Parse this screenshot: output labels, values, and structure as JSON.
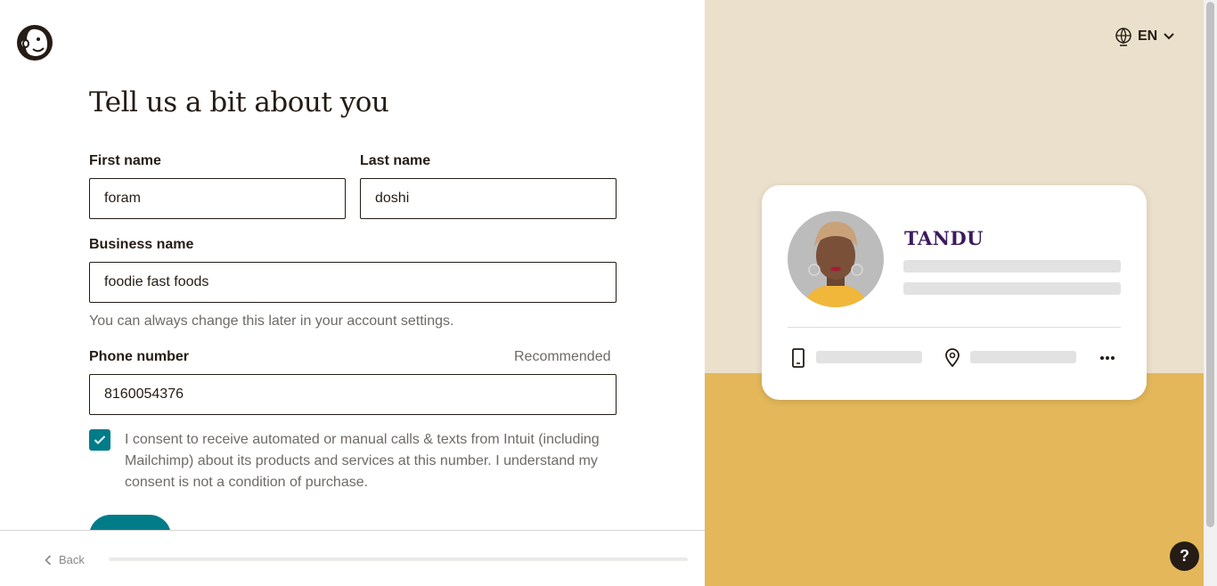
{
  "header": {
    "title": "Tell us a bit about you"
  },
  "form": {
    "first_name": {
      "label": "First name",
      "value": "foram"
    },
    "last_name": {
      "label": "Last name",
      "value": "doshi"
    },
    "business_name": {
      "label": "Business name",
      "value": "foodie fast foods",
      "hint": "You can always change this later in your account settings."
    },
    "phone": {
      "label": "Phone number",
      "tag": "Recommended",
      "value": "8160054376"
    },
    "consent": {
      "checked": true,
      "text": "I consent to receive automated or manual calls & texts from Intuit (including Mailchimp) about its products and services at this number. I understand my consent is not a condition of purchase."
    }
  },
  "footer": {
    "back_label": "Back",
    "progress": 0
  },
  "language": {
    "code": "EN"
  },
  "preview_card": {
    "brand": "TANDU"
  },
  "help": {
    "label": "?"
  },
  "colors": {
    "teal": "#007c89",
    "cream": "#ebe0cb",
    "mustard": "#e4b75a",
    "ink": "#241c15"
  }
}
